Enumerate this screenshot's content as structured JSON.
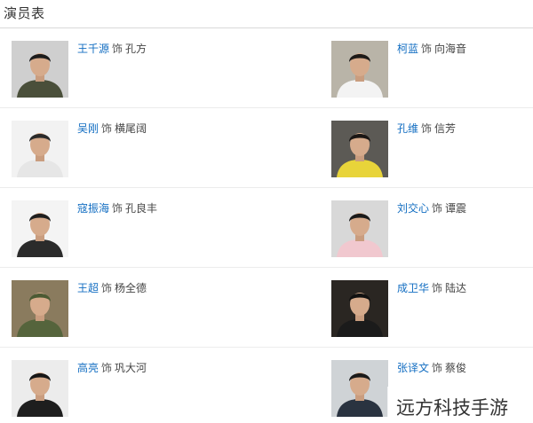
{
  "section": {
    "title": "演员表"
  },
  "role_verb": "饰",
  "cast": [
    {
      "actor": "王千源",
      "role": "孔方",
      "photo": "actor-portrait",
      "bg": "#cfcfcf",
      "shirt": "#4a4f3a",
      "hair": "#1c1c1c"
    },
    {
      "actor": "柯蓝",
      "role": "向海音",
      "photo": "actor-portrait",
      "bg": "#b9b4a8",
      "shirt": "#f3f3f3",
      "hair": "#1d1a18"
    },
    {
      "actor": "吴刚",
      "role": "横尾阔",
      "photo": "actor-portrait",
      "bg": "#f2f2f2",
      "shirt": "#e6e6e6",
      "hair": "#2a2a2a"
    },
    {
      "actor": "孔维",
      "role": "信芳",
      "photo": "actor-portrait",
      "bg": "#5c5a55",
      "shirt": "#e8d43a",
      "hair": "#1a1614"
    },
    {
      "actor": "寇振海",
      "role": "孔良丰",
      "photo": "actor-portrait",
      "bg": "#f4f4f4",
      "shirt": "#2b2b2b",
      "hair": "#1f1f1f"
    },
    {
      "actor": "刘交心",
      "role": "谭震",
      "photo": "actor-portrait",
      "bg": "#d8d8d8",
      "shirt": "#f1c8cf",
      "hair": "#1a1a1a"
    },
    {
      "actor": "王超",
      "role": "杨全德",
      "photo": "actor-portrait",
      "bg": "#8a7b5e",
      "shirt": "#55643c",
      "hair": "#4b5a33"
    },
    {
      "actor": "成卫华",
      "role": "陆达",
      "photo": "actor-portrait",
      "bg": "#2a2622",
      "shirt": "#1b1b1b",
      "hair": "#111111"
    },
    {
      "actor": "高亮",
      "role": "巩大河",
      "photo": "actor-portrait",
      "bg": "#ececec",
      "shirt": "#1e1e1e",
      "hair": "#161616"
    },
    {
      "actor": "张译文",
      "role": "蔡俊",
      "photo": "actor-portrait",
      "bg": "#cfd3d6",
      "shirt": "#2a3340",
      "hair": "#1a1a1a"
    }
  ],
  "watermark": {
    "text": "远方科技手游"
  }
}
